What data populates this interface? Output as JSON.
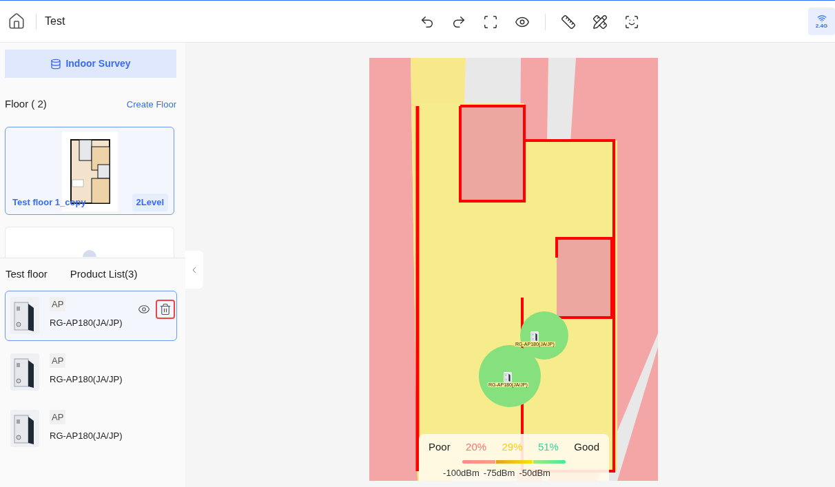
{
  "header": {
    "title": "Test",
    "band": "2.4G",
    "tools": [
      {
        "kind": "undo"
      },
      {
        "kind": "redo"
      },
      {
        "kind": "fit"
      },
      {
        "kind": "view"
      },
      {
        "kind": "divider"
      },
      {
        "kind": "measure"
      },
      {
        "kind": "calibrate"
      },
      {
        "kind": "locate"
      }
    ]
  },
  "sidebar": {
    "survey_button": "Indoor Survey",
    "floor_heading": "Floor ( 2)",
    "create_floor": "Create Floor",
    "floors": [
      {
        "name": "Test floor 1_copy",
        "level": "2Level",
        "selected": true
      },
      {
        "selected": false
      }
    ]
  },
  "panel": {
    "tabs": [
      {
        "label": "Test floor"
      },
      {
        "label": "Product List(3)"
      }
    ],
    "products": [
      {
        "type": "AP",
        "name": "RG-AP180(JA/JP)",
        "selected": true
      },
      {
        "type": "AP",
        "name": "RG-AP180(JA/JP)",
        "selected": false
      },
      {
        "type": "AP",
        "name": "RG-AP180(JA/JP)",
        "selected": false
      }
    ]
  },
  "map": {
    "aps": [
      {
        "label": "RG-AP180(JA/JP)"
      },
      {
        "label": "RG-AP180(JA/JP)"
      }
    ],
    "legend": {
      "poor": "Poor",
      "good": "Good",
      "shares": [
        {
          "text": "20%",
          "color": "#f87171"
        },
        {
          "text": "29%",
          "color": "#facc15"
        },
        {
          "text": "51%",
          "color": "#34d399"
        }
      ],
      "scale": [
        "-100dBm",
        "-75dBm",
        "-50dBm"
      ]
    }
  }
}
